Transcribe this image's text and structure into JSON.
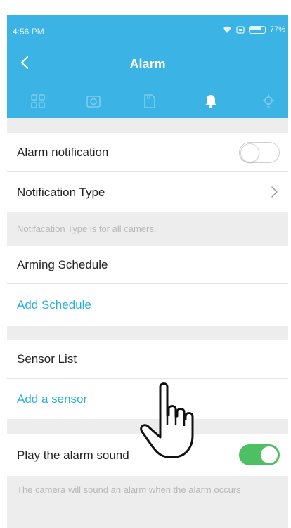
{
  "status_bar": {
    "time": "4:56 PM",
    "battery": "77%"
  },
  "header": {
    "title": "Alarm",
    "background_color": "#3bb3e4",
    "tabs": [
      {
        "icon": "grid-icon",
        "active": false
      },
      {
        "icon": "camera-icon",
        "active": false
      },
      {
        "icon": "sd-card-icon",
        "active": false
      },
      {
        "icon": "bell-icon",
        "active": true
      },
      {
        "icon": "light-bulb-icon",
        "active": false
      }
    ]
  },
  "settings": {
    "alarm_notification": {
      "label": "Alarm notification",
      "enabled": false
    },
    "notification_type": {
      "label": "Notification Type"
    },
    "notification_note": "Notifacation Type is for all camers.",
    "arming_schedule": {
      "label": "Arming Schedule",
      "add_label": "Add Schedule"
    },
    "sensor_list": {
      "label": "Sensor List",
      "add_label": "Add a sensor"
    },
    "play_alarm_sound": {
      "label": "Play the alarm sound",
      "enabled": true
    },
    "alarm_sound_note": "The camera will sound an alarm when the alarm occurs"
  },
  "colors": {
    "accent": "#2aaee0",
    "toggle_on": "#4fbf63",
    "section_gap": "#ededed"
  }
}
